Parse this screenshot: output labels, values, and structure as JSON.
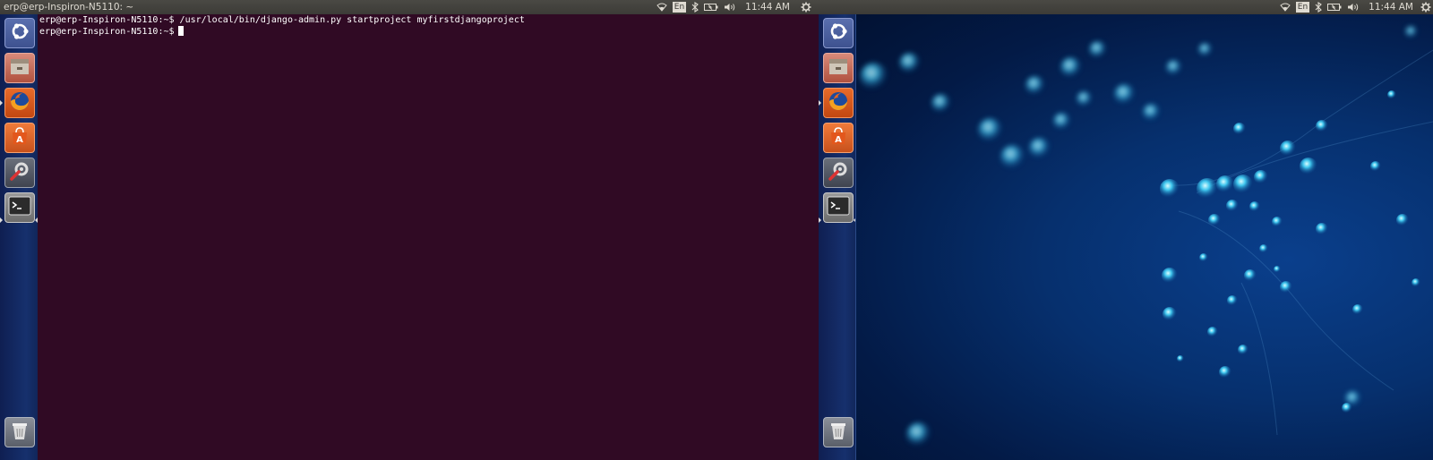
{
  "panel_left": {
    "window_title": "erp@erp-Inspiron-N5110: ~",
    "keyboard_layout": "En",
    "clock": "11:44 AM"
  },
  "panel_right": {
    "keyboard_layout": "En",
    "clock": "11:44 AM"
  },
  "launcher": {
    "items": [
      {
        "name": "dash-home",
        "icon": "ubuntu-logo-icon"
      },
      {
        "name": "files",
        "icon": "file-manager-icon"
      },
      {
        "name": "firefox",
        "icon": "firefox-icon"
      },
      {
        "name": "software-center",
        "icon": "software-center-icon"
      },
      {
        "name": "system-settings",
        "icon": "settings-icon"
      },
      {
        "name": "terminal",
        "icon": "terminal-icon"
      },
      {
        "name": "trash",
        "icon": "trash-icon"
      }
    ]
  },
  "terminal": {
    "line1_prompt": "erp@erp-Inspiron-N5110:~$",
    "line1_command": "/usr/local/bin/django-admin.py startproject myfirstdjangoproject",
    "line2_prompt": "erp@erp-Inspiron-N5110:~$"
  },
  "colors": {
    "terminal_bg": "#300a24",
    "panel_bg": "#3c3b37",
    "launcher_bg": "#16306d",
    "wallpaper_blue": "#0a3f8c"
  }
}
